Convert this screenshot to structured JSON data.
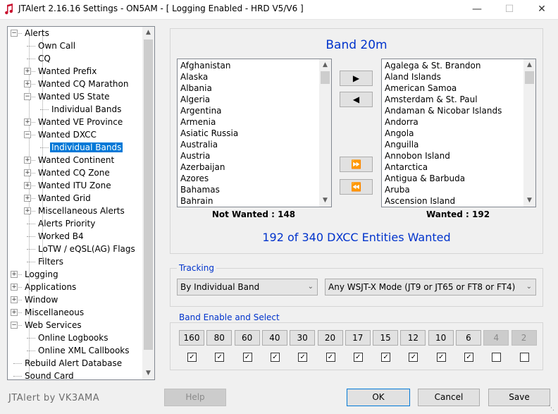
{
  "window": {
    "title": "JTAlert 2.16.16 Settings  -  ON5AM  -  [ Logging Enabled - HRD V5/V6 ]",
    "minimize_icon": "minimize-icon",
    "maximize_icon": "maximize-icon",
    "close_icon": "close-icon"
  },
  "tree": {
    "items": [
      {
        "label": "Alerts"
      },
      {
        "label": "Own Call"
      },
      {
        "label": "CQ"
      },
      {
        "label": "Wanted Prefix"
      },
      {
        "label": "Wanted CQ Marathon"
      },
      {
        "label": "Wanted US State"
      },
      {
        "label": "Individual Bands"
      },
      {
        "label": "Wanted VE Province"
      },
      {
        "label": "Wanted DXCC"
      },
      {
        "label": "Individual Bands"
      },
      {
        "label": "Wanted Continent"
      },
      {
        "label": "Wanted CQ Zone"
      },
      {
        "label": "Wanted ITU Zone"
      },
      {
        "label": "Wanted Grid"
      },
      {
        "label": "Miscellaneous Alerts"
      },
      {
        "label": "Alerts Priority"
      },
      {
        "label": "Worked B4"
      },
      {
        "label": "LoTW / eQSL(AG) Flags"
      },
      {
        "label": "Filters"
      },
      {
        "label": "Logging"
      },
      {
        "label": "Applications"
      },
      {
        "label": "Window"
      },
      {
        "label": "Miscellaneous"
      },
      {
        "label": "Web Services"
      },
      {
        "label": "Online Logbooks"
      },
      {
        "label": "Online XML Callbooks"
      },
      {
        "label": "Rebuild Alert Database"
      },
      {
        "label": "Sound Card"
      }
    ]
  },
  "band": {
    "title": "Band 20m",
    "not_wanted_list": [
      "Afghanistan",
      "Alaska",
      "Albania",
      "Algeria",
      "Argentina",
      "Armenia",
      "Asiatic Russia",
      "Australia",
      "Austria",
      "Azerbaijan",
      "Azores",
      "Bahamas",
      "Bahrain"
    ],
    "wanted_list": [
      "Agalega & St. Brandon",
      "Aland Islands",
      "American Samoa",
      "Amsterdam & St. Paul",
      "Andaman & Nicobar Islands",
      "Andorra",
      "Angola",
      "Anguilla",
      "Annobon Island",
      "Antarctica",
      "Antigua & Barbuda",
      "Aruba",
      "Ascension Island"
    ],
    "not_wanted_label": "Not Wanted : 148",
    "wanted_label": "Wanted : 192",
    "summary": "192 of 340 DXCC Entities Wanted",
    "move_buttons": [
      "▶",
      "◀",
      "⏩",
      "⏪"
    ]
  },
  "tracking": {
    "title": "Tracking",
    "mode_value": "By Individual Band",
    "wsjt_value": "Any WSJT-X Mode (JT9 or JT65 or FT8 or FT4)"
  },
  "band_enable": {
    "title": "Band Enable and Select",
    "bands": [
      {
        "label": "160",
        "enabled": true,
        "checked": true
      },
      {
        "label": "80",
        "enabled": true,
        "checked": true
      },
      {
        "label": "60",
        "enabled": true,
        "checked": true
      },
      {
        "label": "40",
        "enabled": true,
        "checked": true
      },
      {
        "label": "30",
        "enabled": true,
        "checked": true
      },
      {
        "label": "20",
        "enabled": true,
        "checked": true
      },
      {
        "label": "17",
        "enabled": true,
        "checked": true
      },
      {
        "label": "15",
        "enabled": true,
        "checked": true
      },
      {
        "label": "12",
        "enabled": true,
        "checked": true
      },
      {
        "label": "10",
        "enabled": true,
        "checked": true
      },
      {
        "label": "6",
        "enabled": true,
        "checked": true
      },
      {
        "label": "4",
        "enabled": false,
        "checked": false
      },
      {
        "label": "2",
        "enabled": false,
        "checked": false
      }
    ]
  },
  "footer": {
    "credit": "JTAlert by VK3AMA",
    "help": "Help",
    "ok": "OK",
    "cancel": "Cancel",
    "save": "Save"
  },
  "colors": {
    "accent": "#0033cc",
    "selection": "#0078d7"
  }
}
